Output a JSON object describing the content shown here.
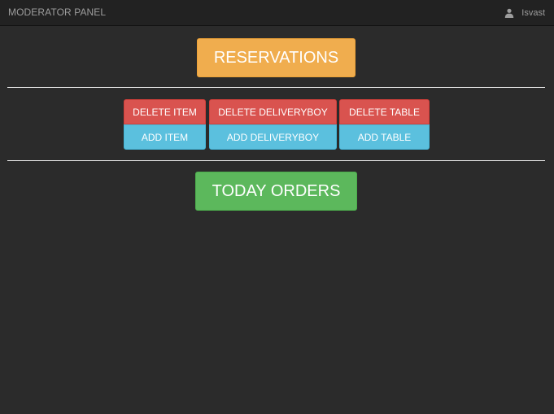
{
  "navbar": {
    "brand": "MODERATOR PANEL",
    "user_icon": "user-icon",
    "username": "Isvast"
  },
  "main": {
    "reservations_label": "RESERVATIONS",
    "today_orders_label": "TODAY ORDERS",
    "groups": [
      {
        "delete_label": "DELETE ITEM",
        "add_label": "ADD ITEM"
      },
      {
        "delete_label": "DELETE DELIVERYBOY",
        "add_label": "ADD DELIVERYBOY"
      },
      {
        "delete_label": "DELETE TABLE",
        "add_label": "ADD TABLE"
      }
    ]
  },
  "colors": {
    "background": "#2b2b2b",
    "navbar": "#222222",
    "warning": "#f0ad4e",
    "danger": "#d9534f",
    "info": "#5bc0de",
    "success": "#5cb85c"
  }
}
